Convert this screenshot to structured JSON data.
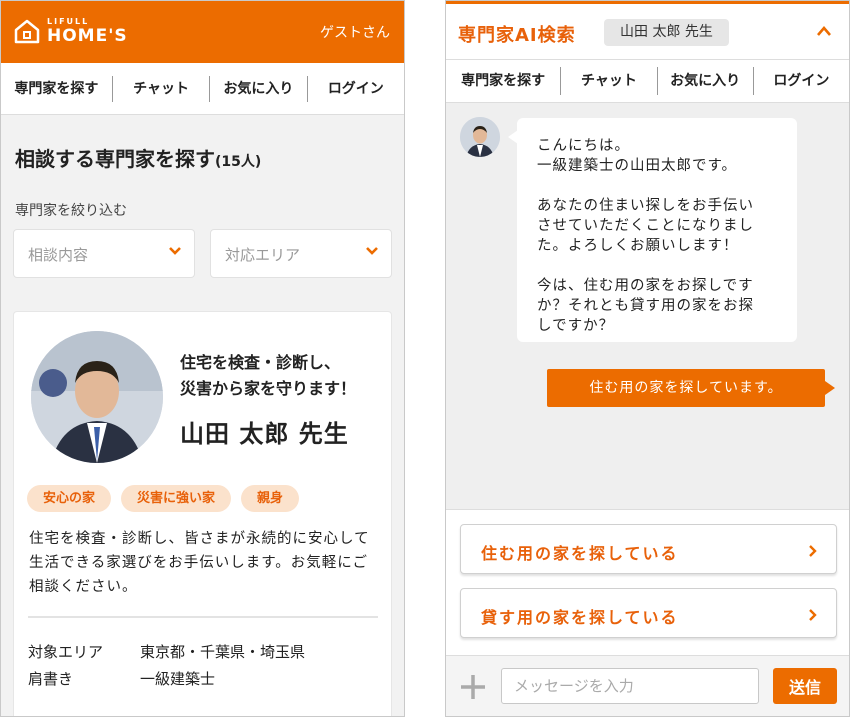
{
  "brand": {
    "small": "LIFULL",
    "big": "HOME'S",
    "accent": "#ec6c00"
  },
  "header": {
    "guest_label": "ゲストさん"
  },
  "nav": {
    "items": [
      "専門家を探す",
      "チャット",
      "お気に入り",
      "ログイン"
    ]
  },
  "search": {
    "title": "相談する専門家を探す",
    "count": "(15人)",
    "filter_label": "専門家を絞り込む",
    "dropdown_topic": "相談内容",
    "dropdown_area": "対応エリア"
  },
  "expert_card": {
    "catch_line1": "住宅を検査・診断し、",
    "catch_line2": "災害から家を守ります！",
    "name": "山田 太郎 先生",
    "tags": [
      "安心の家",
      "災害に強い家",
      "親身"
    ],
    "description": "住宅を検査・診断し、皆さまが永続的に安心して生活できる家選びをお手伝いします。お気軽にご相談ください。",
    "area_label": "対象エリア",
    "area_value": "東京都・千葉県・埼玉県",
    "title_label": "肩書き",
    "title_value": "一級建築士"
  },
  "chat": {
    "panel_title": "専門家AI検索",
    "expert_chip": "山田 太郎 先生",
    "greeting_lines": [
      "こんにちは。",
      "一級建築士の山田太郎です。",
      "",
      "あなたの住まい探しをお手伝い",
      "させていただくことになりまし",
      "た。よろしくお願いします！",
      "",
      "今は、住む用の家をお探しです",
      "か？それとも貸す用の家をお探",
      "しですか？"
    ],
    "user_reply": "住む用の家を探しています。",
    "options": [
      "住む用の家を探している",
      "貸す用の家を探している"
    ],
    "input_placeholder": "メッセージを入力",
    "send_label": "送信"
  }
}
